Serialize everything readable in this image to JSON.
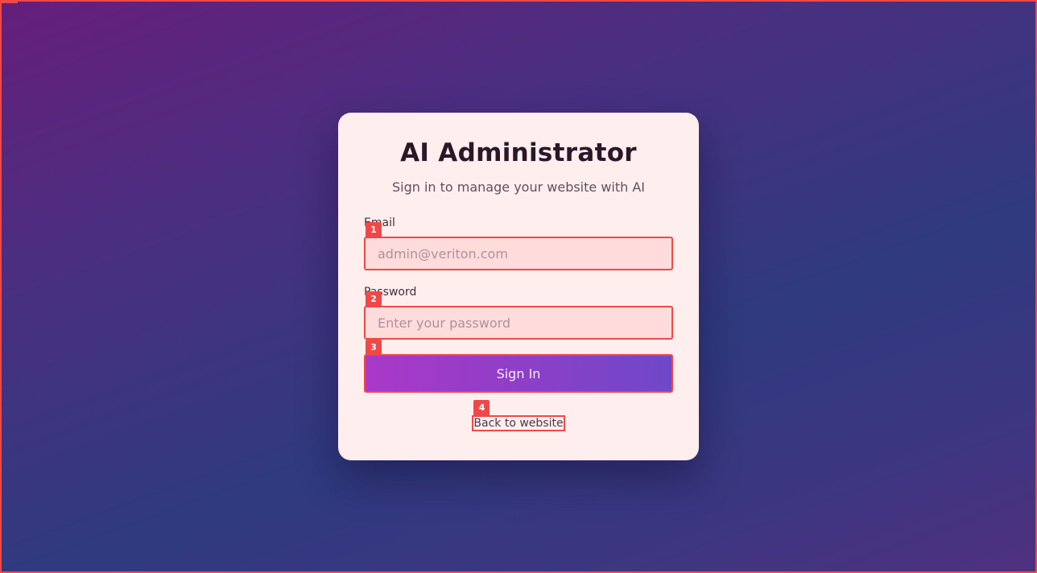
{
  "login": {
    "title": "AI Administrator",
    "subtitle": "Sign in to manage your website with AI",
    "email": {
      "label": "Email",
      "placeholder": "admin@veriton.com",
      "value": ""
    },
    "password": {
      "label": "Password",
      "placeholder": "Enter your password",
      "value": ""
    },
    "submit_label": "Sign In",
    "back_link_label": "Back to website"
  },
  "markers": {
    "email": "1",
    "password": "2",
    "submit": "3",
    "back": "4"
  },
  "colors": {
    "background_start": "#661e7b",
    "background_end": "#2f3a7f",
    "card": "#ffeeee",
    "input_fill": "#ffdcdc",
    "button_gradient_start": "#aa38c8",
    "button_gradient_end": "#6e48c8",
    "highlight_outline": "#f04848"
  }
}
